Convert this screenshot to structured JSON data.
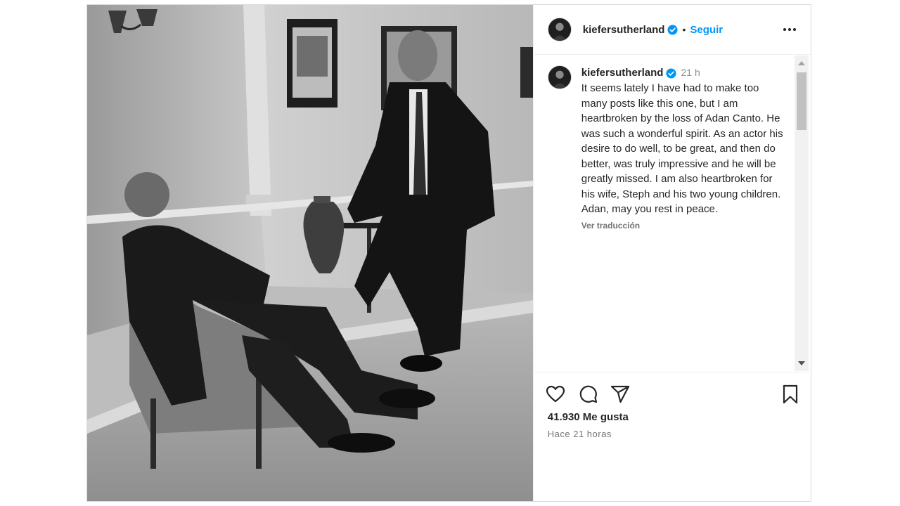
{
  "post": {
    "username": "kiefersutherland",
    "follow_label": "Seguir",
    "separator": "•",
    "caption": {
      "username": "kiefersutherland",
      "time": "21 h",
      "text": "It seems lately I have had to make too many posts like this one, but I am heartbroken by the loss of Adan Canto. He was such a wonderful spirit. As an actor his desire to do well, to be great, and then do better, was truly impressive and he will be greatly missed. I am also heartbroken for his wife, Steph and his two young children. Adan, may you rest in peace.",
      "translate_label": "Ver traducción"
    },
    "likes_label": "41.930 Me gusta",
    "posted_label": "Hace 21 horas"
  },
  "icons": {
    "verified": "verified-badge-icon",
    "more": "more-options-icon",
    "like": "heart-icon",
    "comment": "comment-icon",
    "share": "share-icon",
    "save": "bookmark-icon",
    "scroll_up": "scroll-up-arrow-icon",
    "scroll_down": "scroll-down-arrow-icon"
  },
  "colors": {
    "accent": "#0095f6",
    "text": "#262626",
    "muted": "#737373",
    "border": "#dbdbdb"
  }
}
